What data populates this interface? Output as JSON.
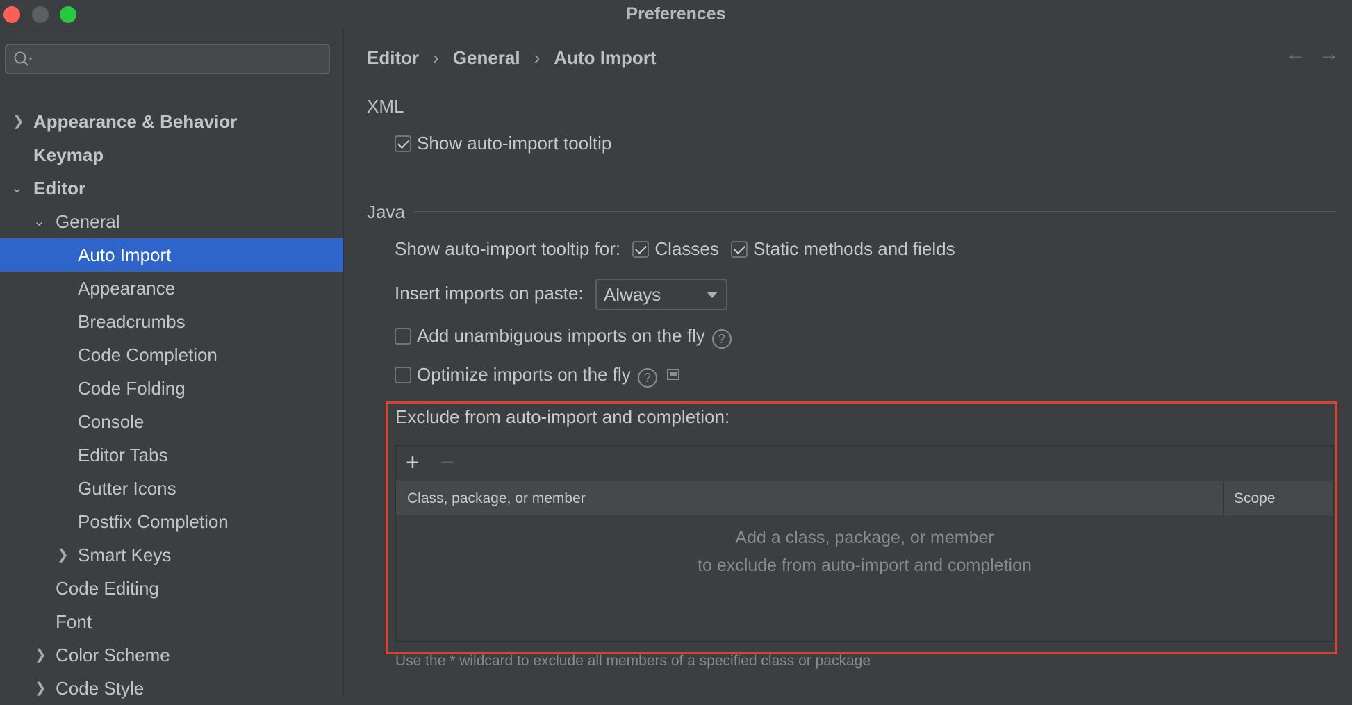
{
  "window": {
    "title": "Preferences"
  },
  "sidebar": {
    "search_placeholder": "",
    "items": [
      {
        "label": "Appearance & Behavior"
      },
      {
        "label": "Keymap"
      },
      {
        "label": "Editor"
      },
      {
        "label": "General"
      },
      {
        "label": "Auto Import"
      },
      {
        "label": "Appearance"
      },
      {
        "label": "Breadcrumbs"
      },
      {
        "label": "Code Completion"
      },
      {
        "label": "Code Folding"
      },
      {
        "label": "Console"
      },
      {
        "label": "Editor Tabs"
      },
      {
        "label": "Gutter Icons"
      },
      {
        "label": "Postfix Completion"
      },
      {
        "label": "Smart Keys"
      },
      {
        "label": "Code Editing"
      },
      {
        "label": "Font"
      },
      {
        "label": "Color Scheme"
      },
      {
        "label": "Code Style"
      }
    ]
  },
  "breadcrumb": [
    "Editor",
    "General",
    "Auto Import"
  ],
  "xml": {
    "title": "XML",
    "show_tooltip_label": "Show auto-import tooltip",
    "show_tooltip_checked": true
  },
  "java": {
    "title": "Java",
    "tooltip_for_label": "Show auto-import tooltip for:",
    "classes_label": "Classes",
    "classes_checked": true,
    "static_label": "Static methods and fields",
    "static_checked": true,
    "insert_label": "Insert imports on paste:",
    "insert_value": "Always",
    "unambiguous_label": "Add unambiguous imports on the fly",
    "unambiguous_checked": false,
    "optimize_label": "Optimize imports on the fly",
    "optimize_checked": false
  },
  "exclude": {
    "label": "Exclude from auto-import and completion:",
    "add_glyph": "+",
    "remove_glyph": "−",
    "col_name": "Class, package, or member",
    "col_scope": "Scope",
    "empty_line1": "Add a class, package, or member",
    "empty_line2": "to exclude from auto-import and completion",
    "hint": "Use the * wildcard to exclude all members of a specified class or package"
  },
  "colors": {
    "background": "#3c3f41",
    "selection": "#2f65ca",
    "highlight_border": "#e0402a"
  }
}
